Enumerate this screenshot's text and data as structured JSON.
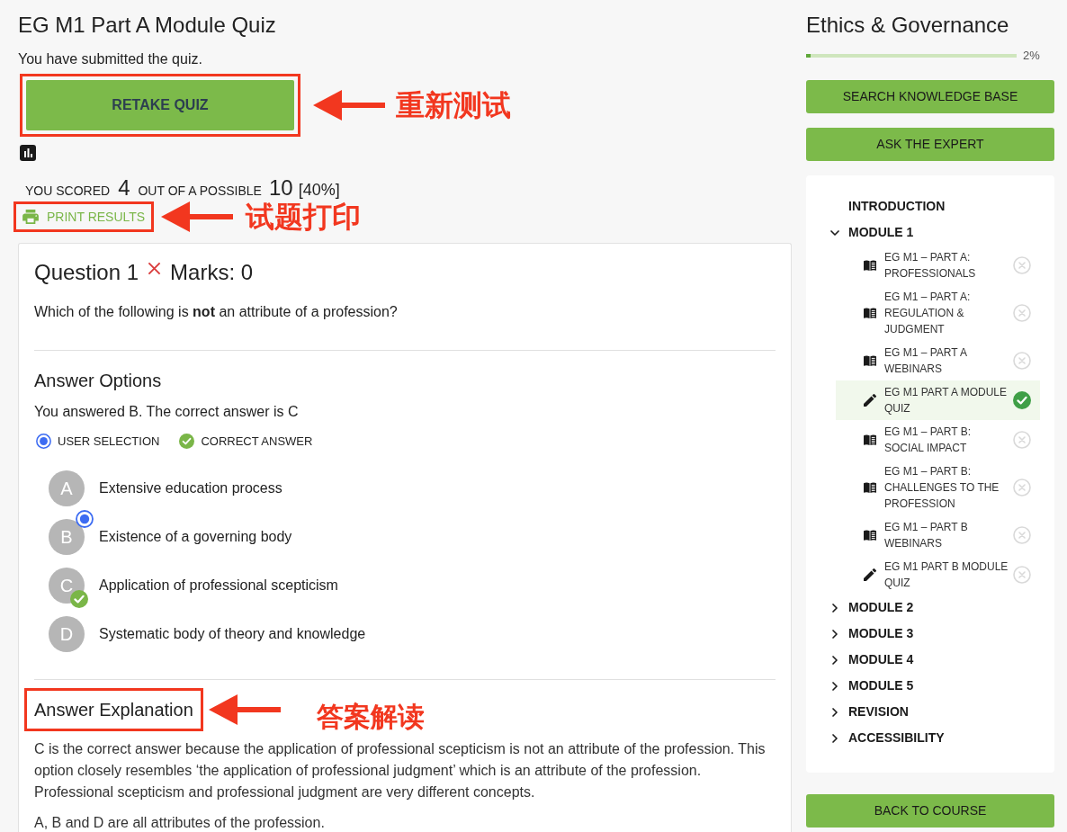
{
  "main": {
    "title": "EG M1 Part A Module Quiz",
    "status": "You have submitted the quiz.",
    "retake_button": {
      "label": "RETAKE QUIZ",
      "annotation": "重新测试"
    },
    "score": {
      "prefix": "YOU SCORED",
      "value": "4",
      "middle": "OUT OF A POSSIBLE",
      "total": "10",
      "percent": "[40%]"
    },
    "print_button": {
      "label": "PRINT RESULTS",
      "annotation": "试题打印"
    }
  },
  "question": {
    "title": "Question 1",
    "correct": false,
    "marks": "Marks: 0",
    "text": "Which of the following is **not** an attribute of a profession?"
  },
  "answer_options": {
    "heading": "Answer Options",
    "summary": "You answered B. The correct answer is C",
    "legend": [
      {
        "kind": "user_selection",
        "label": "USER SELECTION"
      },
      {
        "kind": "correct_answer",
        "label": "CORRECT ANSWER"
      }
    ],
    "options": [
      {
        "letter": "A",
        "text": "Extensive education process",
        "selected": false,
        "correct": false
      },
      {
        "letter": "B",
        "text": "Existence of a governing body",
        "selected": true,
        "correct": false
      },
      {
        "letter": "C",
        "text": "Application of professional scepticism",
        "selected": false,
        "correct": true
      },
      {
        "letter": "D",
        "text": "Systematic body of theory and knowledge",
        "selected": false,
        "correct": false
      }
    ]
  },
  "explanation": {
    "heading": "Answer Explanation",
    "annotation": "答案解读",
    "paragraphs": [
      "C is the correct answer because the application of professional scepticism is not an attribute of the profession. This option closely resembles ‘the application of professional judgment’ which is an attribute of the profession. Professional scepticism and professional judgment are very different concepts.",
      "A, B and D are all attributes of the profession."
    ]
  },
  "sidebar": {
    "title": "Ethics & Governance",
    "progress": {
      "level": 0.02,
      "reading": "2%"
    },
    "buttons": [
      "SEARCH KNOWLEDGE BASE",
      "ASK THE EXPERT"
    ],
    "outline": [
      {
        "kind": "link",
        "label": "INTRODUCTION"
      },
      {
        "kind": "section",
        "label": "MODULE 1",
        "expanded": true,
        "children": [
          {
            "kind": "reading",
            "label": "EG M1 – PART A: PROFESSIONALS",
            "completed": false,
            "selected": false
          },
          {
            "kind": "reading",
            "label": "EG M1 – PART A: REGULATION & JUDGMENT",
            "completed": false,
            "selected": false
          },
          {
            "kind": "reading",
            "label": "EG M1 – PART A WEBINARS",
            "completed": false,
            "selected": false
          },
          {
            "kind": "quiz",
            "label": "EG M1 PART A MODULE QUIZ",
            "completed": true,
            "selected": true
          },
          {
            "kind": "reading",
            "label": "EG M1 – PART B: SOCIAL IMPACT",
            "completed": false,
            "selected": false
          },
          {
            "kind": "reading",
            "label": "EG M1 – PART B: CHALLENGES TO THE PROFESSION",
            "completed": false,
            "selected": false
          },
          {
            "kind": "reading",
            "label": "EG M1 – PART B WEBINARS",
            "completed": false,
            "selected": false
          },
          {
            "kind": "quiz",
            "label": "EG M1 PART B MODULE QUIZ",
            "completed": false,
            "selected": false
          }
        ]
      },
      {
        "kind": "section",
        "label": "MODULE 2",
        "expanded": false
      },
      {
        "kind": "section",
        "label": "MODULE 3",
        "expanded": false
      },
      {
        "kind": "section",
        "label": "MODULE 4",
        "expanded": false
      },
      {
        "kind": "section",
        "label": "MODULE 5",
        "expanded": false
      },
      {
        "kind": "section",
        "label": "REVISION",
        "expanded": false
      },
      {
        "kind": "section",
        "label": "ACCESSIBILITY",
        "expanded": false
      }
    ],
    "back_button": "BACK TO COURSE"
  }
}
